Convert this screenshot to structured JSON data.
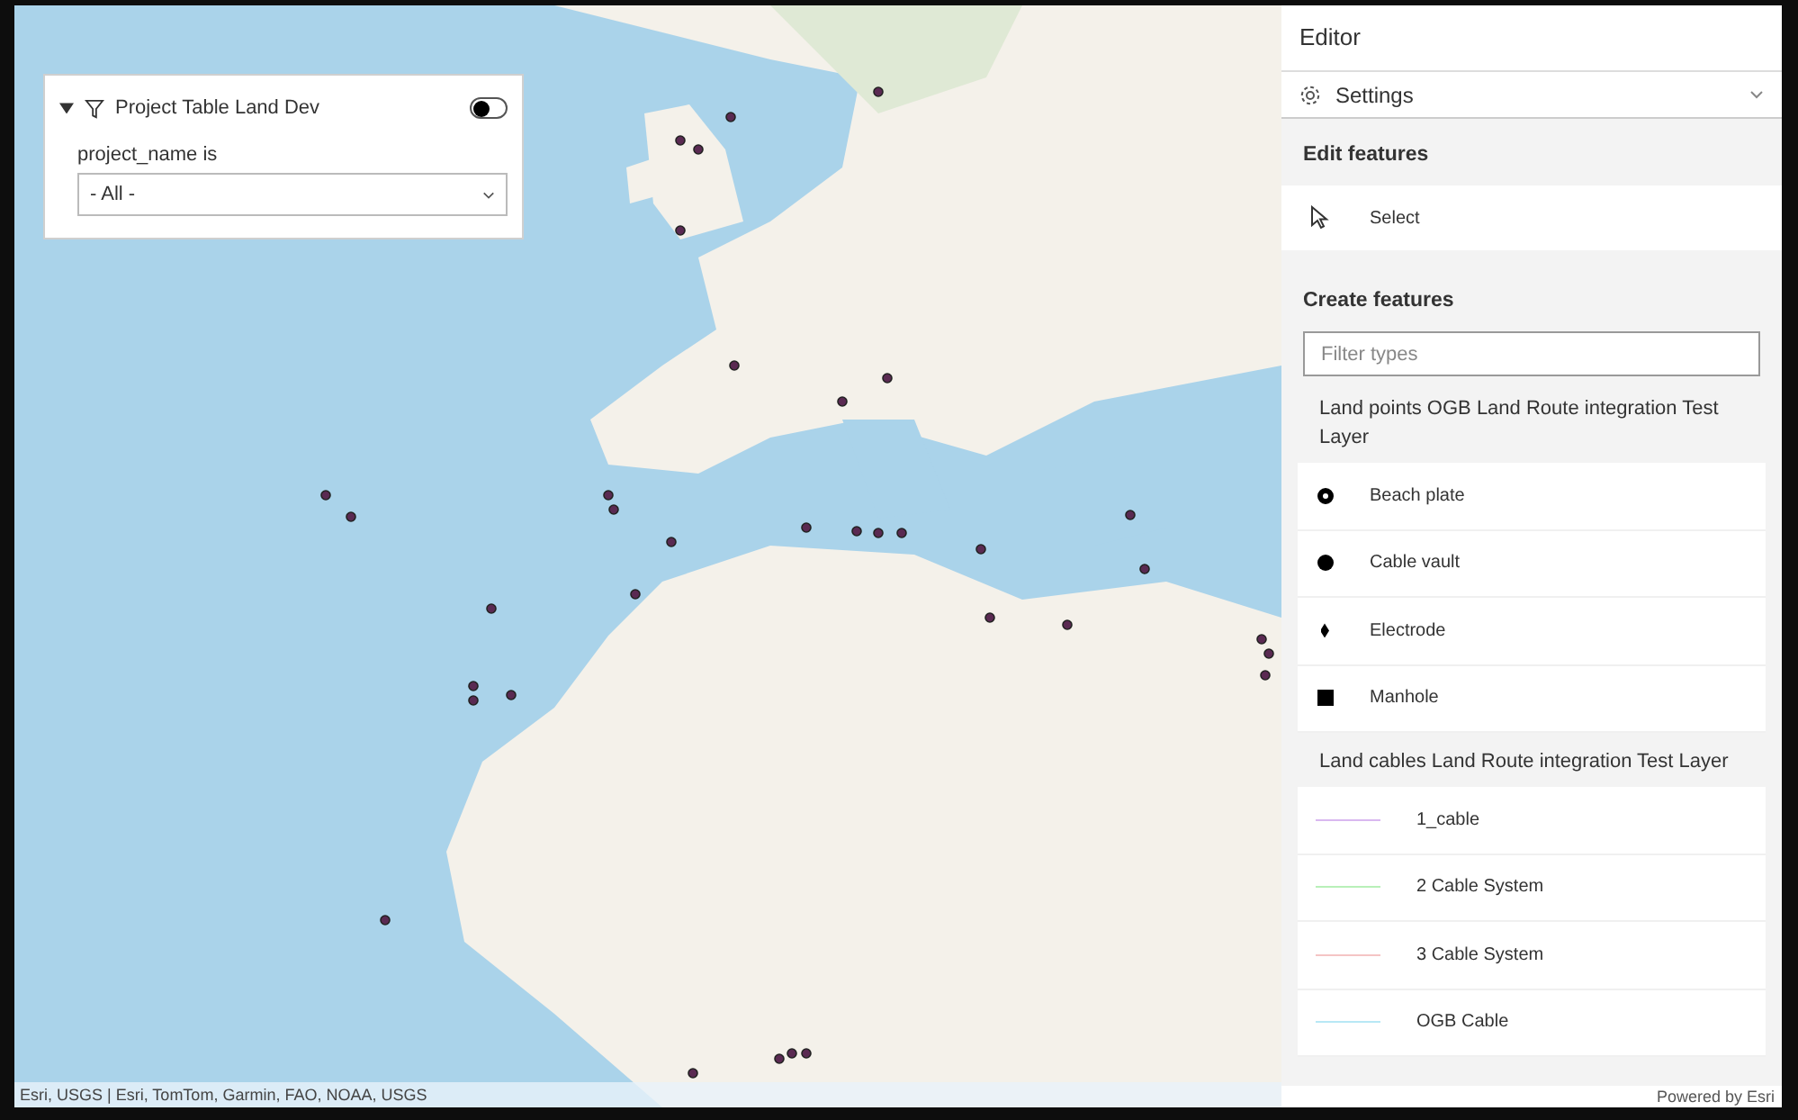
{
  "filter_panel": {
    "title": "Project Table Land Dev",
    "expanded": true,
    "toggle_on": false,
    "field_label": "project_name is",
    "select_value": "- All -"
  },
  "map": {
    "attribution": "Esri, USGS | Esri, TomTom, Garmin, FAO, NOAA, USGS",
    "powered_by": "Powered by Esri"
  },
  "editor": {
    "title": "Editor",
    "settings_label": "Settings",
    "edit_features_heading": "Edit features",
    "select_tool": "Select",
    "create_features_heading": "Create features",
    "filter_placeholder": "Filter types",
    "layers": [
      {
        "name": "Land points OGB Land Route integration Test Layer",
        "items": [
          {
            "label": "Beach plate",
            "kind": "ring"
          },
          {
            "label": "Cable vault",
            "kind": "circle"
          },
          {
            "label": "Electrode",
            "kind": "diamond"
          },
          {
            "label": "Manhole",
            "kind": "square"
          }
        ]
      },
      {
        "name": "Land cables Land Route integration Test Layer",
        "items": [
          {
            "label": "1_cable",
            "kind": "line",
            "color": "#d9b8f0"
          },
          {
            "label": "2 Cable System",
            "kind": "line",
            "color": "#b8f0b8"
          },
          {
            "label": "3 Cable System",
            "kind": "line",
            "color": "#f5c4c4"
          },
          {
            "label": "OGB Cable",
            "kind": "line",
            "color": "#b8e8f5"
          }
        ]
      }
    ]
  }
}
